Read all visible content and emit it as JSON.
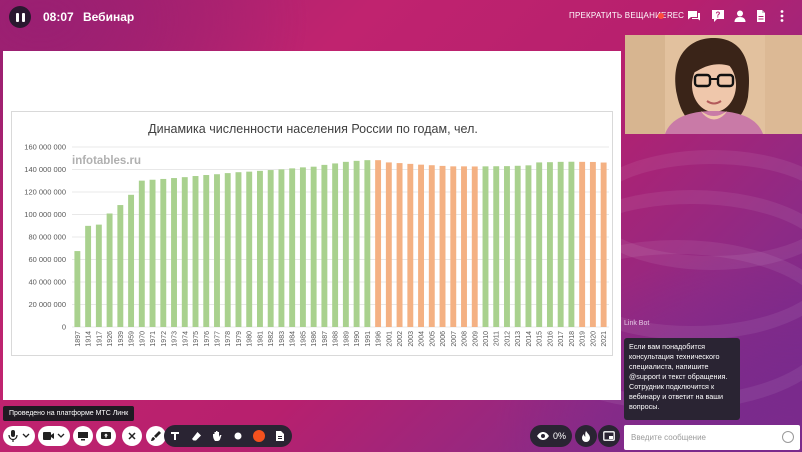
{
  "header": {
    "timer": "08:07",
    "title": "Вебинар",
    "stop_label": "ПРЕКРАТИТЬ ВЕЩАНИЕ",
    "rec_label": "REC",
    "icons": [
      "chat-icon",
      "question-icon",
      "participants-icon",
      "document-icon",
      "more-icon"
    ]
  },
  "chart_data": {
    "type": "bar",
    "title": "Динамика численности населения России по годам, чел.",
    "watermark": "infotables.ru",
    "ylim": [
      0,
      160000000
    ],
    "yticks": [
      "0",
      "20 000 000",
      "40 000 000",
      "60 000 000",
      "80 000 000",
      "100 000 000",
      "120 000 000",
      "140 000 000",
      "160 000 000"
    ],
    "grid": true,
    "colors": {
      "growth": "#a9d18e",
      "decline": "#f4b183"
    },
    "categories": [
      "1897",
      "1914",
      "1917",
      "1926",
      "1939",
      "1959",
      "1970",
      "1971",
      "1972",
      "1973",
      "1974",
      "1975",
      "1976",
      "1977",
      "1978",
      "1979",
      "1980",
      "1981",
      "1982",
      "1983",
      "1984",
      "1985",
      "1986",
      "1987",
      "1988",
      "1989",
      "1990",
      "1991",
      "1996",
      "2001",
      "2002",
      "2003",
      "2004",
      "2005",
      "2006",
      "2007",
      "2008",
      "2009",
      "2010",
      "2011",
      "2012",
      "2013",
      "2014",
      "2015",
      "2016",
      "2017",
      "2018",
      "2019",
      "2020",
      "2021"
    ],
    "values": [
      67500000,
      89900000,
      91000000,
      100900000,
      108400000,
      117500000,
      130100000,
      130900000,
      131600000,
      132400000,
      133200000,
      134200000,
      135100000,
      135800000,
      136800000,
      137600000,
      138100000,
      138800000,
      139500000,
      140100000,
      141000000,
      141900000,
      142500000,
      144100000,
      145400000,
      146800000,
      147700000,
      148300000,
      148300000,
      146300000,
      145700000,
      145000000,
      144300000,
      143800000,
      143200000,
      142800000,
      142800000,
      142700000,
      142800000,
      142900000,
      143000000,
      143300000,
      143700000,
      146300000,
      146500000,
      146800000,
      146900000,
      146800000,
      146700000,
      146200000
    ],
    "bar_colors": [
      "growth",
      "growth",
      "growth",
      "growth",
      "growth",
      "growth",
      "growth",
      "growth",
      "growth",
      "growth",
      "growth",
      "growth",
      "growth",
      "growth",
      "growth",
      "growth",
      "growth",
      "growth",
      "growth",
      "growth",
      "growth",
      "growth",
      "growth",
      "growth",
      "growth",
      "growth",
      "growth",
      "growth",
      "decline",
      "decline",
      "decline",
      "decline",
      "decline",
      "decline",
      "decline",
      "decline",
      "decline",
      "decline",
      "growth",
      "growth",
      "growth",
      "growth",
      "growth",
      "growth",
      "growth",
      "growth",
      "growth",
      "decline",
      "decline",
      "decline"
    ]
  },
  "chat": {
    "bot_name": "Link Bot",
    "message": "Если вам понадобится консультация технического специалиста, напишите @support и текст обращения. Сотрудник подключится к вебинару и ответит на ваши вопросы.",
    "input_placeholder": "Введите сообщение"
  },
  "tooltip": "Проведено на платформе МТС Линк",
  "toolbar": {
    "viewers_percent": "0%",
    "draw_color": "#f4511e"
  }
}
